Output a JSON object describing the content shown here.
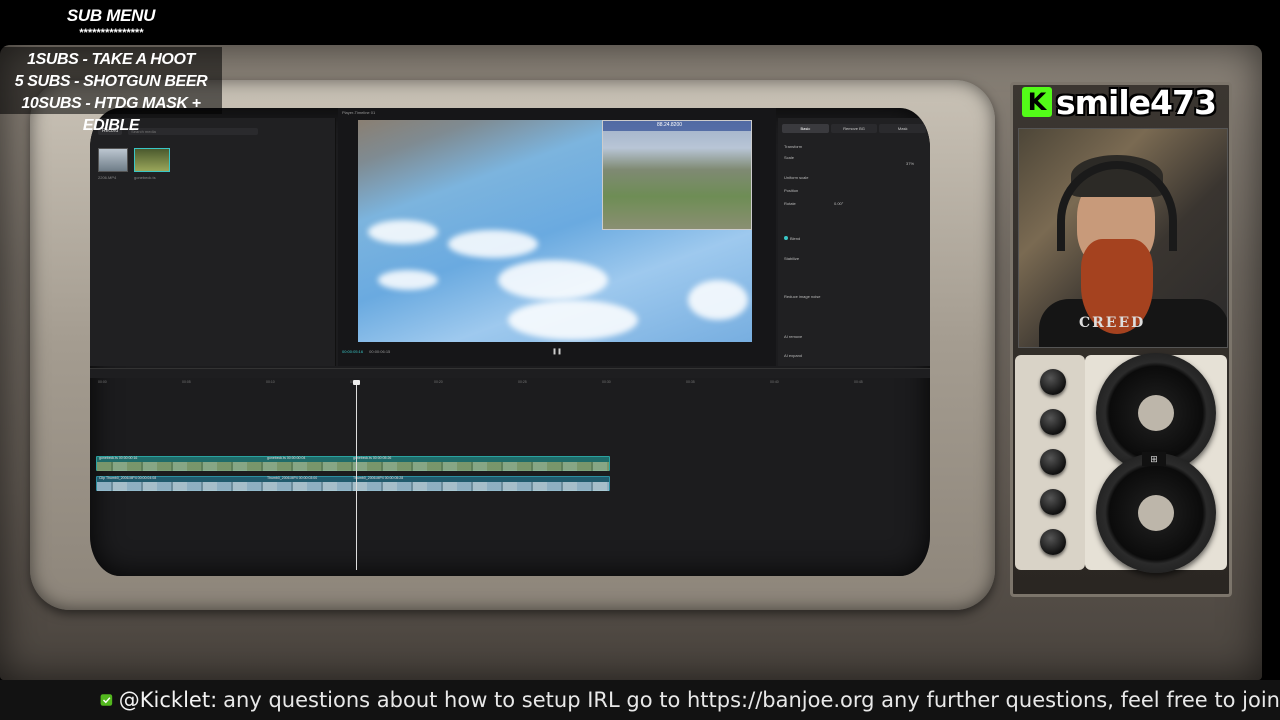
{
  "sub_menu": {
    "title": "SUB MENU",
    "stars": "***************",
    "items": [
      "1SUBS   - TAKE A HOOT",
      "5 SUBS  - SHOTGUN BEER",
      "10SUBS - HTDG MASK + EDIBLE"
    ]
  },
  "streamer": {
    "platform_icon": "kick-logo-icon",
    "platform_letter": "K",
    "username": "smile473",
    "accent": "#53fc18"
  },
  "editor": {
    "media": {
      "record_label": "Record",
      "search_placeholder": "Search media",
      "thumb_1": "2206.MP4",
      "thumb_2": "gonebeck.ts"
    },
    "player": {
      "title": "Player-Timeline 01",
      "osd_readout": "88.24.8200",
      "current_time": "00:00:05:16",
      "total_time": "00:00:06:15",
      "play_icon": "pause-icon"
    },
    "properties": {
      "tabs": [
        "Basic",
        "Remove BG",
        "Mask"
      ],
      "transform": "Transform",
      "scale": "Scale",
      "scale_value": "37%",
      "uniform_scale": "Uniform scale",
      "position": "Position",
      "rotate": "Rotate",
      "rotate_value": "0.00°",
      "blend": "Blend",
      "stabilize": "Stabilize",
      "reduce_noise": "Reduce image noise",
      "ai_remove": "AI remove",
      "ai_expand": "AI expand"
    },
    "timeline": {
      "ruler": [
        "00:00",
        "00:05",
        "00:10",
        "00:15",
        "00:20",
        "00:25",
        "00:30",
        "00:35",
        "00:40",
        "00:45"
      ],
      "clip_top_a": "gonebeck.ts  00:00:00:16",
      "clip_top_b": "gonebeck.ts  00:00:00:04",
      "clip_top_c": "gonebeck.ts  00:00:05:26",
      "clip_bottom_a": "Clip  Thumb0_2006.MP4  00:00:04:08",
      "clip_bottom_b": "Thumb0_2006.MP4  00:00:03:00",
      "clip_bottom_c": "Thumb0_2006.MP4  00:00:05:28"
    }
  },
  "webcam": {
    "shirt_text": "CREED"
  },
  "ticker": {
    "icon": "kicklet-bot-icon",
    "user": "@Kicklet:",
    "message": "any questions about how to setup IRL go to https://banjoe.org any further questions, feel free to join"
  },
  "colors": {
    "timeline_accent": "#39c6c6",
    "kick_green": "#53fc18"
  }
}
